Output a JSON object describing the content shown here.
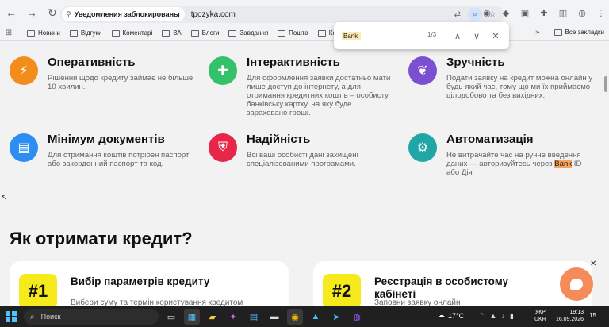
{
  "browser": {
    "site_chip_label": "Уведомления заблокированы",
    "url": "tpozyka.com",
    "bookmarks": [
      "Новини",
      "Відгуки",
      "Коментарі",
      "ВА",
      "Блоги",
      "Завдання",
      "Пошта",
      "Корисні"
    ],
    "all_bookmarks_label": "Все закладки"
  },
  "find": {
    "query": "Bank",
    "count": "1/3"
  },
  "features": [
    {
      "title": "Оперативність",
      "desc": "Рішення щодо кредиту займає не більше 10 хвилин.",
      "color": "#f28c1a",
      "icon": "lightning-icon"
    },
    {
      "title": "Інтерактивність",
      "desc": "Для оформлення заявки достатньо мати лише доступ до інтернету, а для отримання кредитних коштів – особисту банківську картку, на яку буде зараховано гроші.",
      "color": "#35c06a",
      "icon": "gamepad-icon"
    },
    {
      "title": "Зручність",
      "desc": "Подати заявку на кредит можна онлайн у будь-який час, тому що ми їх приймаємо цілодобово та без вихідних.",
      "color": "#7b4fd0",
      "icon": "butterfly-icon"
    },
    {
      "title": "Мінімум документів",
      "desc": "Для отримання коштів потрібен паспорт або закордонний паспорт та код.",
      "color": "#2b8ef0",
      "icon": "document-icon"
    },
    {
      "title": "Надійність",
      "desc": "Всі ваші особисті дані захищені спеціалізованими програмами.",
      "color": "#e8264a",
      "icon": "shield-icon"
    },
    {
      "title": "Автоматизація",
      "desc_before": "Не витрачайте час на ручне введення даних — авторизуйтесь через ",
      "desc_highlight": "Bank",
      "desc_after": " ID або Дія",
      "color": "#20a6a6",
      "icon": "gear-icon"
    }
  ],
  "section_title": "Як отримати кредит?",
  "steps": [
    {
      "badge": "#1",
      "title": "Вибір параметрів кредиту",
      "desc": "Вибери суму та термін користування кредитом"
    },
    {
      "badge": "#2",
      "title": "Реєстрація в особистому кабінеті",
      "desc": "Заповни заявку онлайн"
    }
  ],
  "taskbar": {
    "search_placeholder": "Поиск",
    "temperature": "17°C",
    "lang_1": "УКР",
    "lang_2": "UKR",
    "time": "19:13",
    "date": "16.09.2026",
    "notifications": "15"
  }
}
